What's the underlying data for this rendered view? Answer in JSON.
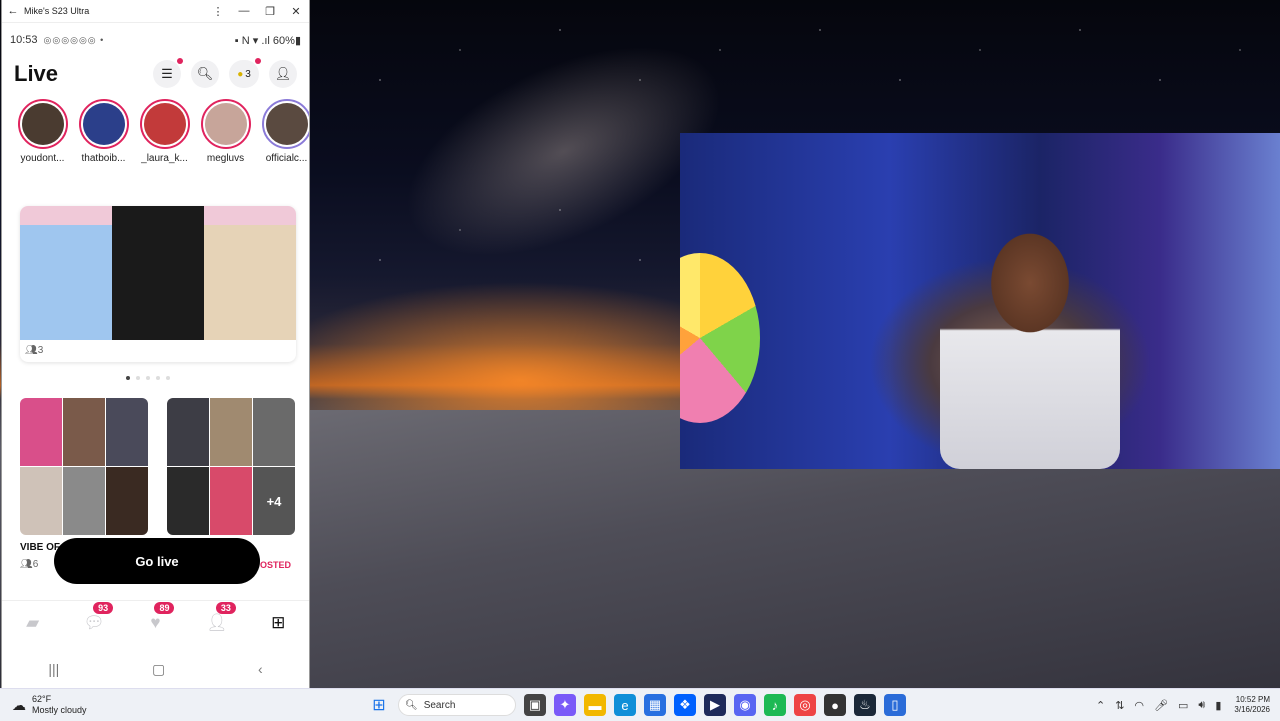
{
  "window": {
    "title": "Mike's S23 Ultra"
  },
  "status_bar": {
    "time": "10:53",
    "notifications": "◎◎◎◎◎◎ •",
    "right": "▪ N ▾ .ıl 60%▮"
  },
  "app": {
    "title": "Live",
    "coins": "3"
  },
  "stories": [
    {
      "name": "youdont...",
      "color": "#4a3b30"
    },
    {
      "name": "thatboib...",
      "color": "#2b3f8a"
    },
    {
      "name": "_laura_k...",
      "color": "#c23a3a"
    },
    {
      "name": "megluvs",
      "color": "#c7a59a"
    },
    {
      "name": "officialc...",
      "color": "#5a4a40"
    }
  ],
  "feed": {
    "big_card": {
      "viewers": "3",
      "tiles": [
        "#f0c9d8",
        "#1a1a1a",
        "#e6d3b7"
      ]
    },
    "card_left": {
      "label": "VIBE OF",
      "viewers": "6"
    },
    "card_right": {
      "more": "+4",
      "boosted": "BOOSTED"
    }
  },
  "go_live_label": "Go live",
  "nav_badges": {
    "messages": "93",
    "likes": "89",
    "friends": "33"
  },
  "taskbar": {
    "weather_temp": "62°F",
    "weather_desc": "Mostly cloudy",
    "search_placeholder": "Search",
    "time": "10:52 PM",
    "date": "3/16/2026"
  }
}
